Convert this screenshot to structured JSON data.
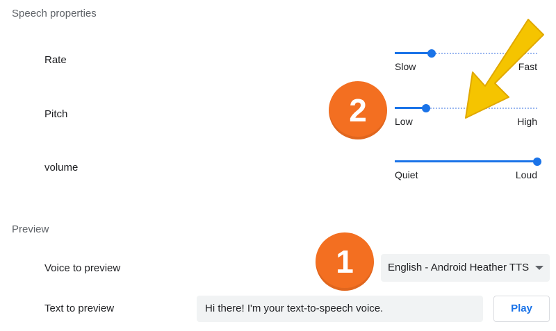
{
  "speech_properties": {
    "title": "Speech properties",
    "rate": {
      "label": "Rate",
      "min_label": "Slow",
      "max_label": "Fast",
      "value": 0.26
    },
    "pitch": {
      "label": "Pitch",
      "min_label": "Low",
      "max_label": "High",
      "value": 0.22
    },
    "volume": {
      "label": "volume",
      "min_label": "Quiet",
      "max_label": "Loud",
      "value": 1.0
    }
  },
  "preview": {
    "title": "Preview",
    "voice_label": "Voice to preview",
    "voice_selected": "English - Android Heather TTS",
    "text_label": "Text to preview",
    "text_value": "Hi there! I'm your text-to-speech voice.",
    "play_label": "Play"
  },
  "annotations": {
    "badge_1": "1",
    "badge_2": "2",
    "badge_color": "#f36f21",
    "arrow_color": "#f5c400"
  },
  "accent_color": "#1a73e8"
}
